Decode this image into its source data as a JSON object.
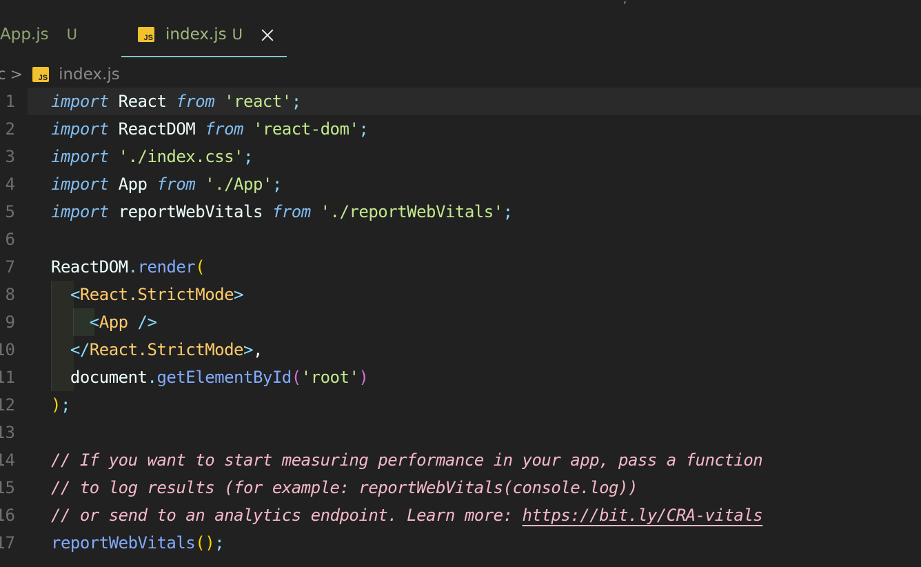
{
  "tabs": [
    {
      "label": "App.js",
      "status": "U",
      "active": false
    },
    {
      "label": "index.js",
      "status": "U",
      "active": true,
      "icon": "js-file-icon"
    }
  ],
  "top_overflow_text": "· · ·, · · ·",
  "breadcrumb": {
    "prefix": "c",
    "separator": ">",
    "file_label": "index.js",
    "icon": "js-file-icon"
  },
  "icon_text": "JS",
  "colors": {
    "background": "#212121",
    "keyword": "#82bdf0",
    "string": "#c3e88d",
    "tag": "#ffcb6b",
    "function": "#82aaff",
    "comment": "#f6b8c8",
    "active_tab_underline": "#7fc4c4"
  },
  "code_lines": [
    {
      "n": "1",
      "tokens": [
        {
          "t": "import",
          "c": "kw"
        },
        {
          "t": " React ",
          "c": "id"
        },
        {
          "t": "from",
          "c": "kw"
        },
        {
          "t": " ",
          "c": "id"
        },
        {
          "t": "'react'",
          "c": "str"
        },
        {
          "t": ";",
          "c": "punc"
        }
      ]
    },
    {
      "n": "2",
      "tokens": [
        {
          "t": "import",
          "c": "kw"
        },
        {
          "t": " ReactDOM ",
          "c": "id"
        },
        {
          "t": "from",
          "c": "kw"
        },
        {
          "t": " ",
          "c": "id"
        },
        {
          "t": "'react-dom'",
          "c": "str"
        },
        {
          "t": ";",
          "c": "punc"
        }
      ]
    },
    {
      "n": "3",
      "tokens": [
        {
          "t": "import",
          "c": "kw"
        },
        {
          "t": " ",
          "c": "id"
        },
        {
          "t": "'./index.css'",
          "c": "str"
        },
        {
          "t": ";",
          "c": "punc"
        }
      ]
    },
    {
      "n": "4",
      "tokens": [
        {
          "t": "import",
          "c": "kw"
        },
        {
          "t": " App ",
          "c": "id"
        },
        {
          "t": "from",
          "c": "kw"
        },
        {
          "t": " ",
          "c": "id"
        },
        {
          "t": "'./App'",
          "c": "str"
        },
        {
          "t": ";",
          "c": "punc"
        }
      ]
    },
    {
      "n": "5",
      "tokens": [
        {
          "t": "import",
          "c": "kw"
        },
        {
          "t": " reportWebVitals ",
          "c": "id"
        },
        {
          "t": "from",
          "c": "kw"
        },
        {
          "t": " ",
          "c": "id"
        },
        {
          "t": "'./reportWebVitals'",
          "c": "str"
        },
        {
          "t": ";",
          "c": "punc"
        }
      ]
    },
    {
      "n": "6",
      "tokens": []
    },
    {
      "n": "7",
      "tokens": [
        {
          "t": "ReactDOM",
          "c": "id"
        },
        {
          "t": ".",
          "c": "punc"
        },
        {
          "t": "render",
          "c": "fn"
        },
        {
          "t": "(",
          "c": "paren"
        }
      ]
    },
    {
      "n": "8",
      "tokens": [
        {
          "t": "  ",
          "c": "id"
        },
        {
          "t": "<",
          "c": "punc"
        },
        {
          "t": "React.StrictMode",
          "c": "tag"
        },
        {
          "t": ">",
          "c": "punc"
        }
      ]
    },
    {
      "n": "9",
      "tokens": [
        {
          "t": "    ",
          "c": "id"
        },
        {
          "t": "<",
          "c": "punc"
        },
        {
          "t": "App",
          "c": "tag"
        },
        {
          "t": " />",
          "c": "punc"
        }
      ]
    },
    {
      "n": "10",
      "tokens": [
        {
          "t": "  ",
          "c": "id"
        },
        {
          "t": "</",
          "c": "punc"
        },
        {
          "t": "React.StrictMode",
          "c": "tag"
        },
        {
          "t": ">",
          "c": "punc"
        },
        {
          "t": ",",
          "c": "id"
        }
      ]
    },
    {
      "n": "11",
      "tokens": [
        {
          "t": "  document",
          "c": "id"
        },
        {
          "t": ".",
          "c": "punc"
        },
        {
          "t": "getElementById",
          "c": "fn"
        },
        {
          "t": "(",
          "c": "paren2"
        },
        {
          "t": "'root'",
          "c": "str"
        },
        {
          "t": ")",
          "c": "paren2"
        }
      ]
    },
    {
      "n": "12",
      "tokens": [
        {
          "t": ")",
          "c": "paren"
        },
        {
          "t": ";",
          "c": "punc"
        }
      ]
    },
    {
      "n": "13",
      "tokens": []
    },
    {
      "n": "14",
      "tokens": [
        {
          "t": "// If you want to start measuring performance in your app, pass a function",
          "c": "cm"
        }
      ]
    },
    {
      "n": "15",
      "tokens": [
        {
          "t": "// to log results (for example: reportWebVitals(console.log))",
          "c": "cm"
        }
      ]
    },
    {
      "n": "16",
      "tokens": [
        {
          "t": "// or send to an analytics endpoint. Learn more: ",
          "c": "cm"
        },
        {
          "t": "https://bit.ly/CRA-vitals",
          "c": "cm link"
        }
      ]
    },
    {
      "n": "17",
      "tokens": [
        {
          "t": "reportWebVitals",
          "c": "fn"
        },
        {
          "t": "()",
          "c": "paren"
        },
        {
          "t": ";",
          "c": "punc"
        }
      ]
    }
  ]
}
